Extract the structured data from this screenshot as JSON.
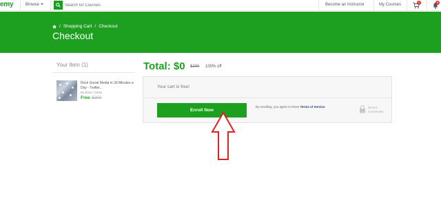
{
  "topnav": {
    "logo": "emy",
    "browse_label": "Browse",
    "search_placeholder": "Search for Courses",
    "become_instructor": "Become an Instructor",
    "my_courses": "My Courses",
    "cart_badge": "1",
    "notif_badge": "4"
  },
  "header": {
    "breadcrumb": [
      "Shopping Cart",
      "Checkout"
    ],
    "separator": "/",
    "title": "Checkout"
  },
  "sidebar": {
    "heading": "Your Item (1)",
    "course": {
      "title": "Rock Social Media in 30 Minutes a Day - Twitter...",
      "author": "By Brian Clarke",
      "price": "Free",
      "old_price": "$200"
    }
  },
  "checkout": {
    "total_label": "Total: $0",
    "old_price": "$200",
    "discount": "100% off",
    "free_message": "Your cart is free!",
    "enroll_label": "Enroll Now",
    "terms_prefix": "By enrolling, you agree to these",
    "terms_link": "Terms of Service",
    "terms_suffix": ".",
    "secure_label": "Secure Connection"
  },
  "colors": {
    "brand_green": "#1da01f",
    "annotation_red": "#e02020",
    "badge_red": "#d93025"
  }
}
